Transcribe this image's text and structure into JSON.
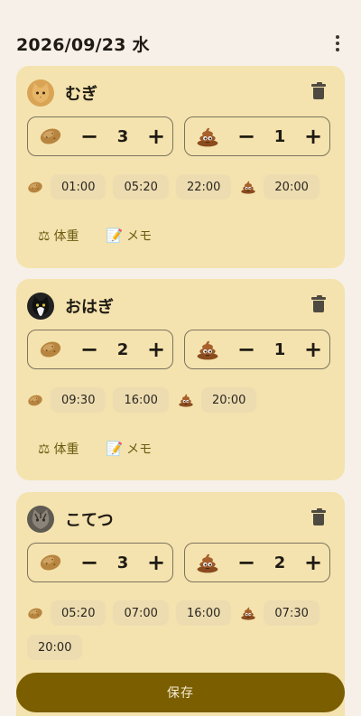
{
  "header": {
    "date": "2026/09/23 水"
  },
  "cats": [
    {
      "name": "むぎ",
      "avatar": "orange-tabby-cat",
      "food_count": "3",
      "poop_count": "1",
      "food_times": [
        "01:00",
        "05:20",
        "22:00"
      ],
      "poop_times": [
        "20:00"
      ],
      "actions": {
        "weight": "体重",
        "memo": "メモ"
      }
    },
    {
      "name": "おはぎ",
      "avatar": "tuxedo-cat",
      "food_count": "2",
      "poop_count": "1",
      "food_times": [
        "09:30",
        "16:00"
      ],
      "poop_times": [
        "20:00"
      ],
      "actions": {
        "weight": "体重",
        "memo": "メモ"
      }
    },
    {
      "name": "こてつ",
      "avatar": "gray-tabby-cat",
      "food_count": "3",
      "poop_count": "2",
      "food_times": [
        "05:20",
        "07:00",
        "16:00"
      ],
      "poop_times": [
        "07:30",
        "20:00"
      ]
    }
  ],
  "controls": {
    "minus": "−",
    "plus": "+"
  },
  "save_label": "保存",
  "colors": {
    "background": "#f6f0e8",
    "card": "#f4e3ae",
    "chip": "#ecdcb0",
    "primary": "#7b5e00",
    "accent_text": "#6b5a10"
  },
  "icons": {
    "food": "potato-icon",
    "poop": "poop-icon",
    "weight": "scale-icon",
    "memo": "memo-icon",
    "delete": "trash-icon",
    "menu": "more-vert-icon"
  }
}
